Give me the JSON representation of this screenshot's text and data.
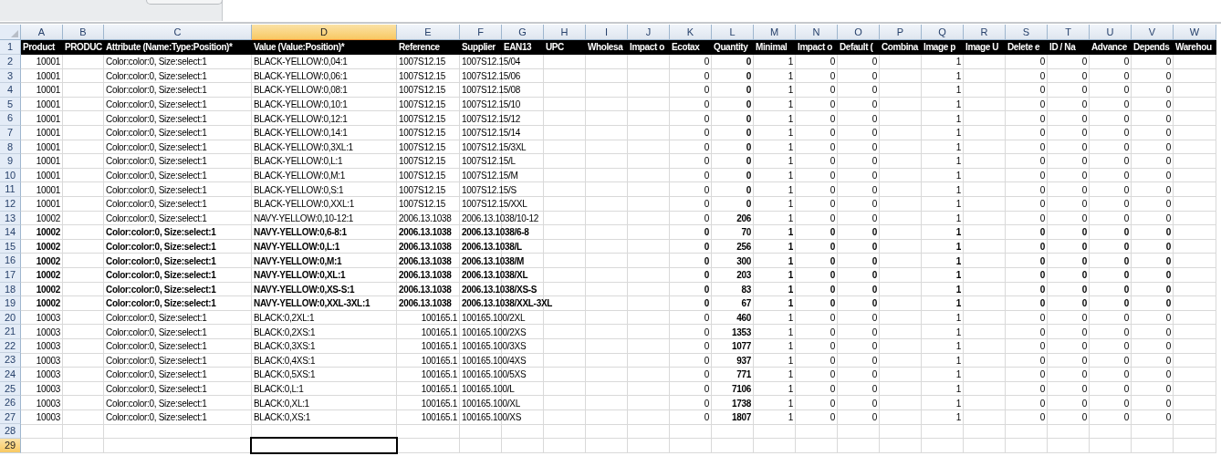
{
  "columns": [
    {
      "letter": "A",
      "title": "Product",
      "selected": false,
      "bold_values": false
    },
    {
      "letter": "B",
      "title": "PRODUC",
      "selected": false
    },
    {
      "letter": "C",
      "title": "Attribute (Name:Type:Position)*",
      "selected": false,
      "bold_values": false
    },
    {
      "letter": "D",
      "title": "Value (Value:Position)*",
      "selected": true,
      "bold_values": false
    },
    {
      "letter": "E",
      "title": "Reference",
      "selected": false,
      "bold_values": false
    },
    {
      "letter": "F",
      "title": "Supplier",
      "selected": false,
      "bold_values": false
    },
    {
      "letter": "G",
      "title": "EAN13",
      "selected": false
    },
    {
      "letter": "H",
      "title": "UPC",
      "selected": false
    },
    {
      "letter": "I",
      "title": "Wholesa",
      "selected": false
    },
    {
      "letter": "J",
      "title": "Impact o",
      "selected": false
    },
    {
      "letter": "K",
      "title": "Ecotax",
      "selected": false,
      "bold_values": false
    },
    {
      "letter": "L",
      "title": "Quantity",
      "selected": false,
      "bold_values": true
    },
    {
      "letter": "M",
      "title": "Minimal",
      "selected": false,
      "bold_values": false
    },
    {
      "letter": "N",
      "title": "Impact o",
      "selected": false,
      "bold_values": false
    },
    {
      "letter": "O",
      "title": "Default (",
      "selected": false,
      "bold_values": false
    },
    {
      "letter": "P",
      "title": "Combina",
      "selected": false
    },
    {
      "letter": "Q",
      "title": "Image p",
      "selected": false,
      "bold_values": false
    },
    {
      "letter": "R",
      "title": "Image U",
      "selected": false
    },
    {
      "letter": "S",
      "title": "Delete e",
      "selected": false,
      "bold_values": false
    },
    {
      "letter": "T",
      "title": "ID / Na",
      "selected": false,
      "bold_values": false
    },
    {
      "letter": "U",
      "title": "Advance",
      "selected": false,
      "bold_values": false
    },
    {
      "letter": "V",
      "title": "Depends",
      "selected": false,
      "bold_values": false
    },
    {
      "letter": "W",
      "title": "Warehou",
      "selected": false
    }
  ],
  "header_row": "1",
  "rows": [
    {
      "number": "2",
      "bold": false,
      "text": {
        "C": "Color:color:0, Size:select:1",
        "D": "BLACK-YELLOW:0,04:1",
        "E": "1007S12.15",
        "F": "1007S12.15/04"
      },
      "numbers": {
        "A": "10001",
        "K": "0",
        "L": "0",
        "M": "1",
        "N": "0",
        "O": "0",
        "Q": "1",
        "S": "0",
        "T": "0",
        "U": "0",
        "V": "0"
      }
    },
    {
      "number": "3",
      "bold": false,
      "text": {
        "C": "Color:color:0, Size:select:1",
        "D": "BLACK-YELLOW:0,06:1",
        "E": "1007S12.15",
        "F": "1007S12.15/06"
      },
      "numbers": {
        "A": "10001",
        "K": "0",
        "L": "0",
        "M": "1",
        "N": "0",
        "O": "0",
        "Q": "1",
        "S": "0",
        "T": "0",
        "U": "0",
        "V": "0"
      }
    },
    {
      "number": "4",
      "bold": false,
      "text": {
        "C": "Color:color:0, Size:select:1",
        "D": "BLACK-YELLOW:0,08:1",
        "E": "1007S12.15",
        "F": "1007S12.15/08"
      },
      "numbers": {
        "A": "10001",
        "K": "0",
        "L": "0",
        "M": "1",
        "N": "0",
        "O": "0",
        "Q": "1",
        "S": "0",
        "T": "0",
        "U": "0",
        "V": "0"
      }
    },
    {
      "number": "5",
      "bold": false,
      "text": {
        "C": "Color:color:0, Size:select:1",
        "D": "BLACK-YELLOW:0,10:1",
        "E": "1007S12.15",
        "F": "1007S12.15/10"
      },
      "numbers": {
        "A": "10001",
        "K": "0",
        "L": "0",
        "M": "1",
        "N": "0",
        "O": "0",
        "Q": "1",
        "S": "0",
        "T": "0",
        "U": "0",
        "V": "0"
      }
    },
    {
      "number": "6",
      "bold": false,
      "text": {
        "C": "Color:color:0, Size:select:1",
        "D": "BLACK-YELLOW:0,12:1",
        "E": "1007S12.15",
        "F": "1007S12.15/12"
      },
      "numbers": {
        "A": "10001",
        "K": "0",
        "L": "0",
        "M": "1",
        "N": "0",
        "O": "0",
        "Q": "1",
        "S": "0",
        "T": "0",
        "U": "0",
        "V": "0"
      }
    },
    {
      "number": "7",
      "bold": false,
      "text": {
        "C": "Color:color:0, Size:select:1",
        "D": "BLACK-YELLOW:0,14:1",
        "E": "1007S12.15",
        "F": "1007S12.15/14"
      },
      "numbers": {
        "A": "10001",
        "K": "0",
        "L": "0",
        "M": "1",
        "N": "0",
        "O": "0",
        "Q": "1",
        "S": "0",
        "T": "0",
        "U": "0",
        "V": "0"
      }
    },
    {
      "number": "8",
      "bold": false,
      "text": {
        "C": "Color:color:0, Size:select:1",
        "D": "BLACK-YELLOW:0,3XL:1",
        "E": "1007S12.15",
        "F": "1007S12.15/3XL"
      },
      "numbers": {
        "A": "10001",
        "K": "0",
        "L": "0",
        "M": "1",
        "N": "0",
        "O": "0",
        "Q": "1",
        "S": "0",
        "T": "0",
        "U": "0",
        "V": "0"
      }
    },
    {
      "number": "9",
      "bold": false,
      "text": {
        "C": "Color:color:0, Size:select:1",
        "D": "BLACK-YELLOW:0,L:1",
        "E": "1007S12.15",
        "F": "1007S12.15/L"
      },
      "numbers": {
        "A": "10001",
        "K": "0",
        "L": "0",
        "M": "1",
        "N": "0",
        "O": "0",
        "Q": "1",
        "S": "0",
        "T": "0",
        "U": "0",
        "V": "0"
      }
    },
    {
      "number": "10",
      "bold": false,
      "text": {
        "C": "Color:color:0, Size:select:1",
        "D": "BLACK-YELLOW:0,M:1",
        "E": "1007S12.15",
        "F": "1007S12.15/M"
      },
      "numbers": {
        "A": "10001",
        "K": "0",
        "L": "0",
        "M": "1",
        "N": "0",
        "O": "0",
        "Q": "1",
        "S": "0",
        "T": "0",
        "U": "0",
        "V": "0"
      }
    },
    {
      "number": "11",
      "bold": false,
      "text": {
        "C": "Color:color:0, Size:select:1",
        "D": "BLACK-YELLOW:0,S:1",
        "E": "1007S12.15",
        "F": "1007S12.15/S"
      },
      "numbers": {
        "A": "10001",
        "K": "0",
        "L": "0",
        "M": "1",
        "N": "0",
        "O": "0",
        "Q": "1",
        "S": "0",
        "T": "0",
        "U": "0",
        "V": "0"
      }
    },
    {
      "number": "12",
      "bold": false,
      "text": {
        "C": "Color:color:0, Size:select:1",
        "D": "BLACK-YELLOW:0,XXL:1",
        "E": "1007S12.15",
        "F": "1007S12.15/XXL"
      },
      "numbers": {
        "A": "10001",
        "K": "0",
        "L": "0",
        "M": "1",
        "N": "0",
        "O": "0",
        "Q": "1",
        "S": "0",
        "T": "0",
        "U": "0",
        "V": "0"
      }
    },
    {
      "number": "13",
      "bold": false,
      "text": {
        "C": "Color:color:0, Size:select:1",
        "D": "NAVY-YELLOW:0,10-12:1",
        "E": "2006.13.1038",
        "F": "2006.13.1038/10-12"
      },
      "numbers": {
        "A": "10002",
        "K": "0",
        "L": "206",
        "M": "1",
        "N": "0",
        "O": "0",
        "Q": "1",
        "S": "0",
        "T": "0",
        "U": "0",
        "V": "0"
      }
    },
    {
      "number": "14",
      "bold": true,
      "text": {
        "C": "Color:color:0, Size:select:1",
        "D": "NAVY-YELLOW:0,6-8:1",
        "E": "2006.13.1038",
        "F": "2006.13.1038/6-8"
      },
      "numbers": {
        "A": "10002",
        "K": "0",
        "L": "70",
        "M": "1",
        "N": "0",
        "O": "0",
        "Q": "1",
        "S": "0",
        "T": "0",
        "U": "0",
        "V": "0"
      }
    },
    {
      "number": "15",
      "bold": true,
      "text": {
        "C": "Color:color:0, Size:select:1",
        "D": "NAVY-YELLOW:0,L:1",
        "E": "2006.13.1038",
        "F": "2006.13.1038/L"
      },
      "numbers": {
        "A": "10002",
        "K": "0",
        "L": "256",
        "M": "1",
        "N": "0",
        "O": "0",
        "Q": "1",
        "S": "0",
        "T": "0",
        "U": "0",
        "V": "0"
      }
    },
    {
      "number": "16",
      "bold": true,
      "text": {
        "C": "Color:color:0, Size:select:1",
        "D": "NAVY-YELLOW:0,M:1",
        "E": "2006.13.1038",
        "F": "2006.13.1038/M"
      },
      "numbers": {
        "A": "10002",
        "K": "0",
        "L": "300",
        "M": "1",
        "N": "0",
        "O": "0",
        "Q": "1",
        "S": "0",
        "T": "0",
        "U": "0",
        "V": "0"
      }
    },
    {
      "number": "17",
      "bold": true,
      "text": {
        "C": "Color:color:0, Size:select:1",
        "D": "NAVY-YELLOW:0,XL:1",
        "E": "2006.13.1038",
        "F": "2006.13.1038/XL"
      },
      "numbers": {
        "A": "10002",
        "K": "0",
        "L": "203",
        "M": "1",
        "N": "0",
        "O": "0",
        "Q": "1",
        "S": "0",
        "T": "0",
        "U": "0",
        "V": "0"
      }
    },
    {
      "number": "18",
      "bold": true,
      "text": {
        "C": "Color:color:0, Size:select:1",
        "D": "NAVY-YELLOW:0,XS-S:1",
        "E": "2006.13.1038",
        "F": "2006.13.1038/XS-S"
      },
      "numbers": {
        "A": "10002",
        "K": "0",
        "L": "83",
        "M": "1",
        "N": "0",
        "O": "0",
        "Q": "1",
        "S": "0",
        "T": "0",
        "U": "0",
        "V": "0"
      }
    },
    {
      "number": "19",
      "bold": true,
      "text": {
        "C": "Color:color:0, Size:select:1",
        "D": "NAVY-YELLOW:0,XXL-3XL:1",
        "E": "2006.13.1038",
        "F": "2006.13.1038/XXL-3XL"
      },
      "numbers": {
        "A": "10002",
        "K": "0",
        "L": "67",
        "M": "1",
        "N": "0",
        "O": "0",
        "Q": "1",
        "S": "0",
        "T": "0",
        "U": "0",
        "V": "0"
      }
    },
    {
      "number": "20",
      "bold": false,
      "text": {
        "C": "Color:color:0, Size:select:1",
        "D": "BLACK:0,2XL:1",
        "F": "100165.100/2XL"
      },
      "numbers": {
        "A": "10003",
        "E": "100165.1",
        "K": "0",
        "L": "460",
        "M": "1",
        "N": "0",
        "O": "0",
        "Q": "1",
        "S": "0",
        "T": "0",
        "U": "0",
        "V": "0"
      }
    },
    {
      "number": "21",
      "bold": false,
      "text": {
        "C": "Color:color:0, Size:select:1",
        "D": "BLACK:0,2XS:1",
        "F": "100165.100/2XS"
      },
      "numbers": {
        "A": "10003",
        "E": "100165.1",
        "K": "0",
        "L": "1353",
        "M": "1",
        "N": "0",
        "O": "0",
        "Q": "1",
        "S": "0",
        "T": "0",
        "U": "0",
        "V": "0"
      }
    },
    {
      "number": "22",
      "bold": false,
      "text": {
        "C": "Color:color:0, Size:select:1",
        "D": "BLACK:0,3XS:1",
        "F": "100165.100/3XS"
      },
      "numbers": {
        "A": "10003",
        "E": "100165.1",
        "K": "0",
        "L": "1077",
        "M": "1",
        "N": "0",
        "O": "0",
        "Q": "1",
        "S": "0",
        "T": "0",
        "U": "0",
        "V": "0"
      }
    },
    {
      "number": "23",
      "bold": false,
      "text": {
        "C": "Color:color:0, Size:select:1",
        "D": "BLACK:0,4XS:1",
        "F": "100165.100/4XS"
      },
      "numbers": {
        "A": "10003",
        "E": "100165.1",
        "K": "0",
        "L": "937",
        "M": "1",
        "N": "0",
        "O": "0",
        "Q": "1",
        "S": "0",
        "T": "0",
        "U": "0",
        "V": "0"
      }
    },
    {
      "number": "24",
      "bold": false,
      "text": {
        "C": "Color:color:0, Size:select:1",
        "D": "BLACK:0,5XS:1",
        "F": "100165.100/5XS"
      },
      "numbers": {
        "A": "10003",
        "E": "100165.1",
        "K": "0",
        "L": "771",
        "M": "1",
        "N": "0",
        "O": "0",
        "Q": "1",
        "S": "0",
        "T": "0",
        "U": "0",
        "V": "0"
      }
    },
    {
      "number": "25",
      "bold": false,
      "text": {
        "C": "Color:color:0, Size:select:1",
        "D": "BLACK:0,L:1",
        "F": "100165.100/L"
      },
      "numbers": {
        "A": "10003",
        "E": "100165.1",
        "K": "0",
        "L": "7106",
        "M": "1",
        "N": "0",
        "O": "0",
        "Q": "1",
        "S": "0",
        "T": "0",
        "U": "0",
        "V": "0"
      }
    },
    {
      "number": "26",
      "bold": false,
      "text": {
        "C": "Color:color:0, Size:select:1",
        "D": "BLACK:0,XL:1",
        "F": "100165.100/XL"
      },
      "numbers": {
        "A": "10003",
        "E": "100165.1",
        "K": "0",
        "L": "1738",
        "M": "1",
        "N": "0",
        "O": "0",
        "Q": "1",
        "S": "0",
        "T": "0",
        "U": "0",
        "V": "0"
      }
    },
    {
      "number": "27",
      "bold": false,
      "text": {
        "C": "Color:color:0, Size:select:1",
        "D": "BLACK:0,XS:1",
        "F": "100165.100/XS"
      },
      "numbers": {
        "A": "10003",
        "E": "100165.1",
        "K": "0",
        "L": "1807",
        "M": "1",
        "N": "0",
        "O": "0",
        "Q": "1",
        "S": "0",
        "T": "0",
        "U": "0",
        "V": "0"
      }
    },
    {
      "number": "28",
      "selected": false
    },
    {
      "number": "29",
      "selected": true
    }
  ]
}
